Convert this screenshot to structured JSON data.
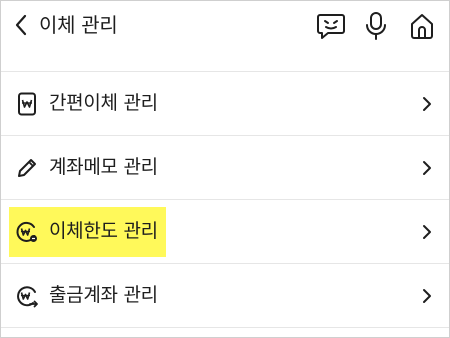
{
  "header": {
    "title": "이체 관리",
    "icons": [
      "back-arrow-icon",
      "chatbot-icon",
      "microphone-icon",
      "home-icon"
    ]
  },
  "menu": {
    "items": [
      {
        "label": "간편이체 관리",
        "icon": "won-card-icon"
      },
      {
        "label": "계좌메모 관리",
        "icon": "pencil-icon"
      },
      {
        "label": "이체한도 관리",
        "icon": "won-limit-icon",
        "highlighted": true
      },
      {
        "label": "출금계좌 관리",
        "icon": "won-transfer-icon"
      }
    ]
  },
  "colors": {
    "highlight": "#fff95a",
    "text": "#1e1e1e",
    "divider": "#e6e6e6"
  }
}
